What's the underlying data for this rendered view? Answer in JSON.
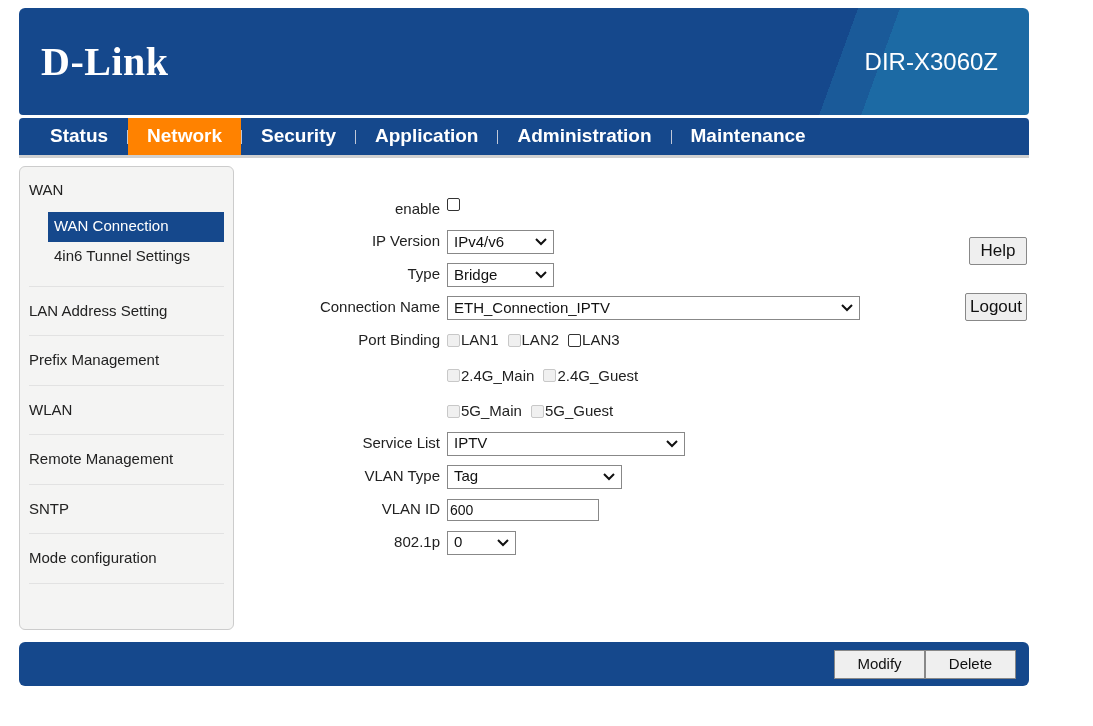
{
  "header": {
    "logo": "D-Link",
    "model": "DIR-X3060Z"
  },
  "nav": [
    {
      "label": "Status",
      "selected": false
    },
    {
      "label": "Network",
      "selected": true
    },
    {
      "label": "Security",
      "selected": false
    },
    {
      "label": "Application",
      "selected": false
    },
    {
      "label": "Administration",
      "selected": false
    },
    {
      "label": "Maintenance",
      "selected": false
    }
  ],
  "sidebar": [
    {
      "label": "WAN",
      "children": [
        {
          "label": "WAN Connection",
          "selected": true
        },
        {
          "label": "4in6 Tunnel Settings",
          "selected": false
        }
      ]
    },
    {
      "label": "LAN Address Setting"
    },
    {
      "label": "Prefix Management"
    },
    {
      "label": "WLAN"
    },
    {
      "label": "Remote Management"
    },
    {
      "label": "SNTP"
    },
    {
      "label": "Mode configuration"
    }
  ],
  "form": [
    {
      "kind": "checkbox",
      "label": "enable",
      "checked": false
    },
    {
      "kind": "select",
      "label": "IP Version",
      "value": "IPv4/v6"
    },
    {
      "kind": "select",
      "label": "Type",
      "value": "Bridge"
    },
    {
      "kind": "select",
      "label": "Connection Name",
      "value": "ETH_Connection_IPTV"
    },
    {
      "kind": "checkboxes",
      "label": "Port Binding",
      "rows": [
        [
          {
            "label": "LAN1",
            "checked": false,
            "disabled": true
          },
          {
            "label": "LAN2",
            "checked": false,
            "disabled": true
          },
          {
            "label": "LAN3",
            "checked": false,
            "disabled": false
          }
        ],
        [
          {
            "label": "2.4G_Main",
            "checked": false,
            "disabled": true
          },
          {
            "label": "2.4G_Guest",
            "checked": false,
            "disabled": true
          }
        ],
        [
          {
            "label": "5G_Main",
            "checked": false,
            "disabled": true
          },
          {
            "label": "5G_Guest",
            "checked": false,
            "disabled": true
          }
        ]
      ]
    },
    {
      "kind": "select",
      "label": "Service List",
      "value": "IPTV"
    },
    {
      "kind": "select",
      "label": "VLAN Type",
      "value": "Tag"
    },
    {
      "kind": "text",
      "label": "VLAN ID",
      "value": "600"
    },
    {
      "kind": "select",
      "label": "802.1p",
      "value": "0"
    }
  ],
  "side_buttons": [
    "Help",
    "Logout"
  ],
  "footer_buttons": [
    "Modify",
    "Delete"
  ]
}
